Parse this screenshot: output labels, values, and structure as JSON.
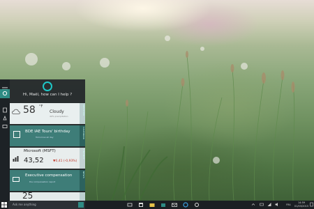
{
  "cortana": {
    "greeting": "Hi, Maël, how can I help ?",
    "weather": {
      "side": "WEATHER",
      "temp": "58",
      "unit": "°F",
      "condition": "Cloudy",
      "detail": "40% precipitation"
    },
    "event": {
      "side": "CALENDAR",
      "title": "BDE IAE Tours' birthday",
      "detail": "Tomorrow all day"
    },
    "stock": {
      "side": "FINANCE",
      "name": "Microsoft (MSFT)",
      "value": "43,52",
      "change": "▼0,41 (-0,93%)"
    },
    "mail": {
      "side": "NEWS",
      "title": "Executive compensation",
      "detail": "the compensation report"
    },
    "partial": {
      "big": "25"
    }
  },
  "taskbar": {
    "search_placeholder": "Ask me anything",
    "language": "FRA",
    "time": "14:59",
    "date": "01/03/2015"
  },
  "icons": [
    "menu-icon",
    "home-icon",
    "notebook-icon",
    "reminder-icon",
    "feedback-icon",
    "cortana-ring-icon",
    "cloud-icon",
    "calendar-icon",
    "stock-icon",
    "mail-icon",
    "windows-start-icon",
    "microphone-icon",
    "task-view-icon",
    "explorer-icon",
    "store-icon",
    "mail-app-icon",
    "ie-icon",
    "settings-icon",
    "chevron-up-icon",
    "network-icon",
    "volume-icon",
    "notification-icon"
  ],
  "colors": {
    "accent": "#2e8b84",
    "cortana_ring": "#1ec8c8",
    "panel": "#22262a",
    "taskbar": "#1b1f23",
    "stock_down": "#c0392b"
  }
}
